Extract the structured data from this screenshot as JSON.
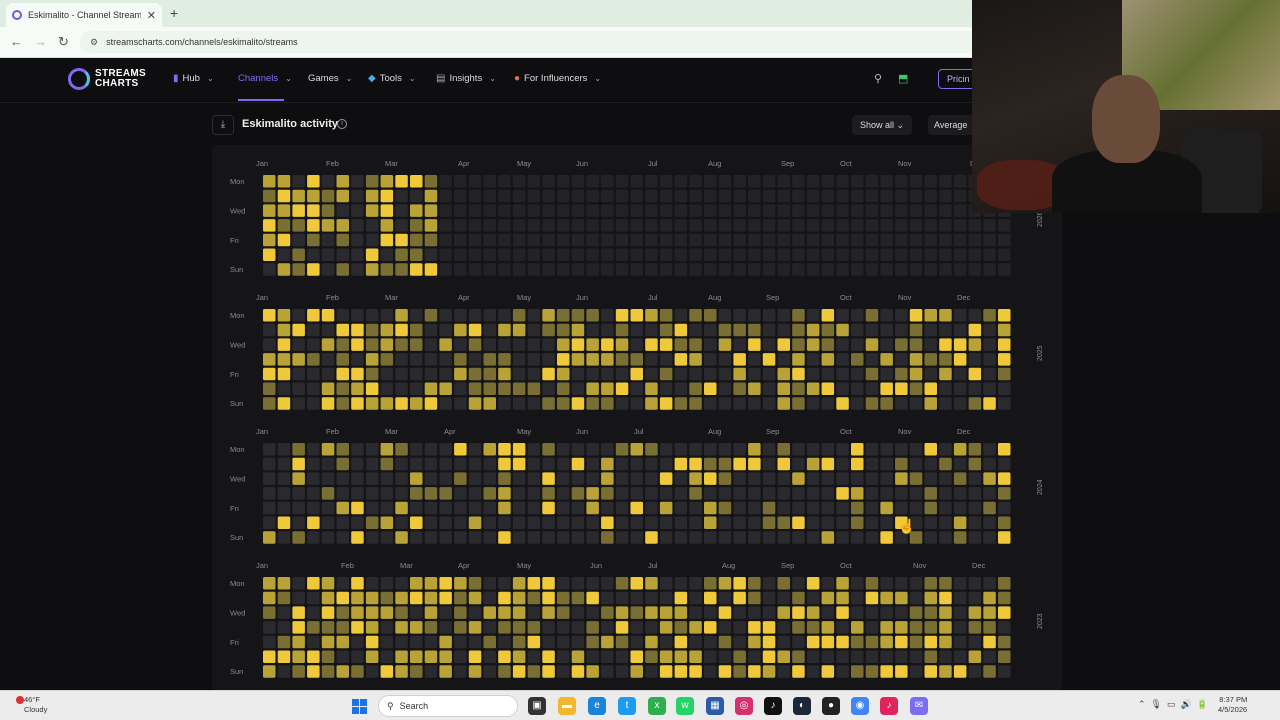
{
  "browser": {
    "tab_title": "Eskimalito - Channel Streams of",
    "url": "streamscharts.com/channels/eskimalito/streams",
    "new_tab": "+"
  },
  "header": {
    "logo_line1": "STREAMS",
    "logo_line2": "CHARTS",
    "nav": [
      {
        "label": "Hub",
        "icon": "bar-chart-icon"
      },
      {
        "label": "Channels",
        "icon": ""
      },
      {
        "label": "Games",
        "icon": ""
      },
      {
        "label": "Tools",
        "icon": "diamond-icon"
      },
      {
        "label": "Insights",
        "icon": "document-icon"
      },
      {
        "label": "For Influencers",
        "icon": "fire-icon"
      }
    ],
    "pricing": "Pricin"
  },
  "panel": {
    "title": "Eskimalito activity",
    "filter": "Show all",
    "metric": "Average"
  },
  "heatmap": {
    "day_labels": [
      "Mon",
      "Wed",
      "Fri",
      "Sun"
    ],
    "years": [
      {
        "year": "2026",
        "months": [
          [
            "Jan",
            48
          ],
          [
            "Feb",
            118
          ],
          [
            "Mar",
            177
          ],
          [
            "Apr",
            250
          ],
          [
            "May",
            309
          ],
          [
            "Jun",
            368
          ],
          [
            "Jul",
            440
          ],
          [
            "Aug",
            500
          ],
          [
            "Sep",
            573
          ],
          [
            "Oct",
            632
          ],
          [
            "Nov",
            690
          ],
          [
            "Dec",
            762
          ]
        ],
        "active_weeks": 12
      },
      {
        "year": "2025",
        "months": [
          [
            "Jan",
            48
          ],
          [
            "Feb",
            118
          ],
          [
            "Mar",
            177
          ],
          [
            "Apr",
            250
          ],
          [
            "May",
            309
          ],
          [
            "Jun",
            368
          ],
          [
            "Jul",
            440
          ],
          [
            "Aug",
            500
          ],
          [
            "Sep",
            558
          ],
          [
            "Oct",
            632
          ],
          [
            "Nov",
            690
          ],
          [
            "Dec",
            749
          ]
        ],
        "active_weeks": 52
      },
      {
        "year": "2024",
        "months": [
          [
            "Jan",
            48
          ],
          [
            "Feb",
            118
          ],
          [
            "Mar",
            177
          ],
          [
            "Apr",
            236
          ],
          [
            "May",
            309
          ],
          [
            "Jun",
            368
          ],
          [
            "Jul",
            426
          ],
          [
            "Aug",
            500
          ],
          [
            "Sep",
            558
          ],
          [
            "Oct",
            632
          ],
          [
            "Nov",
            690
          ],
          [
            "Dec",
            749
          ]
        ],
        "active_weeks": 53
      },
      {
        "year": "2023",
        "months": [
          [
            "Jan",
            48
          ],
          [
            "Feb",
            133
          ],
          [
            "Mar",
            192
          ],
          [
            "Apr",
            250
          ],
          [
            "May",
            309
          ],
          [
            "Jun",
            382
          ],
          [
            "Jul",
            440
          ],
          [
            "Aug",
            514
          ],
          [
            "Sep",
            573
          ],
          [
            "Oct",
            632
          ],
          [
            "Nov",
            705
          ],
          [
            "Dec",
            764
          ]
        ],
        "active_weeks": 52
      }
    ],
    "colors": {
      "empty": "#2a2a2e",
      "low": "#7a6f33",
      "mid": "#b9a336",
      "high": "#f0c93a"
    }
  },
  "taskbar": {
    "weather_temp": "46°F",
    "weather_desc": "Cloudy",
    "search": "Search",
    "time": "8:37 PM",
    "date": "4/5/2026"
  }
}
